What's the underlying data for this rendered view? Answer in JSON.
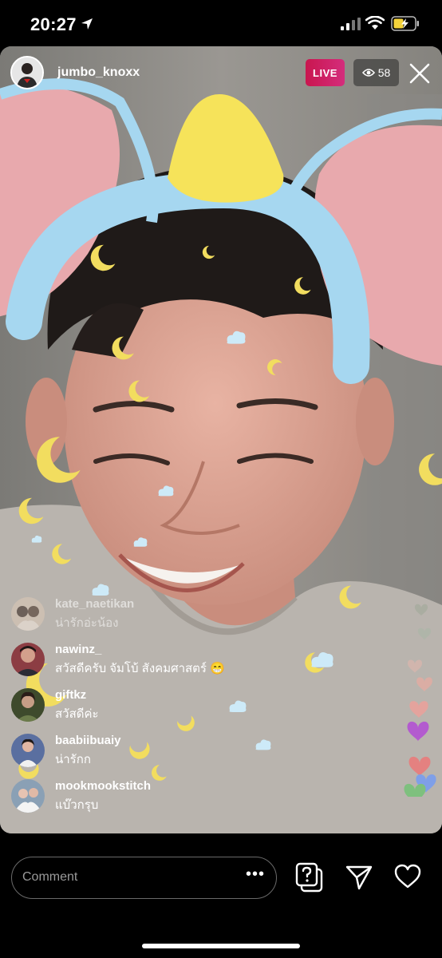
{
  "status_bar": {
    "time": "20:27"
  },
  "live": {
    "host_username": "jumbo_knoxx",
    "live_label": "LIVE",
    "viewer_count": "58"
  },
  "comments": [
    {
      "user": "kate_naetikan",
      "text": "น่ารักอ่ะน้อง"
    },
    {
      "user": "nawinz_",
      "text": "สวัสดีครับ จัมโบ้ สังคมศาสตร์ 😁"
    },
    {
      "user": "giftkz",
      "text": "สวัสดีค่ะ"
    },
    {
      "user": "baabiibuaiy",
      "text": "น่ารักก"
    },
    {
      "user": "mookmookstitch",
      "text": "แบ๊วกรุบ"
    }
  ],
  "composer": {
    "placeholder": "Comment",
    "more_label": "•••"
  },
  "icons": {
    "location": "location-arrow-icon",
    "signal": "cellular-signal-icon",
    "wifi": "wifi-icon",
    "battery": "battery-charging-icon",
    "viewers": "eye-icon",
    "close": "close-icon",
    "questions": "question-card-icon",
    "send": "paper-plane-icon",
    "like": "heart-icon"
  },
  "colors": {
    "live_badge": "#d42d7c",
    "battery": "#f5d33b",
    "ear_pink": "#e8a9ad",
    "headband_blue": "#a6d7f0",
    "hat_yellow": "#f6e35a"
  }
}
